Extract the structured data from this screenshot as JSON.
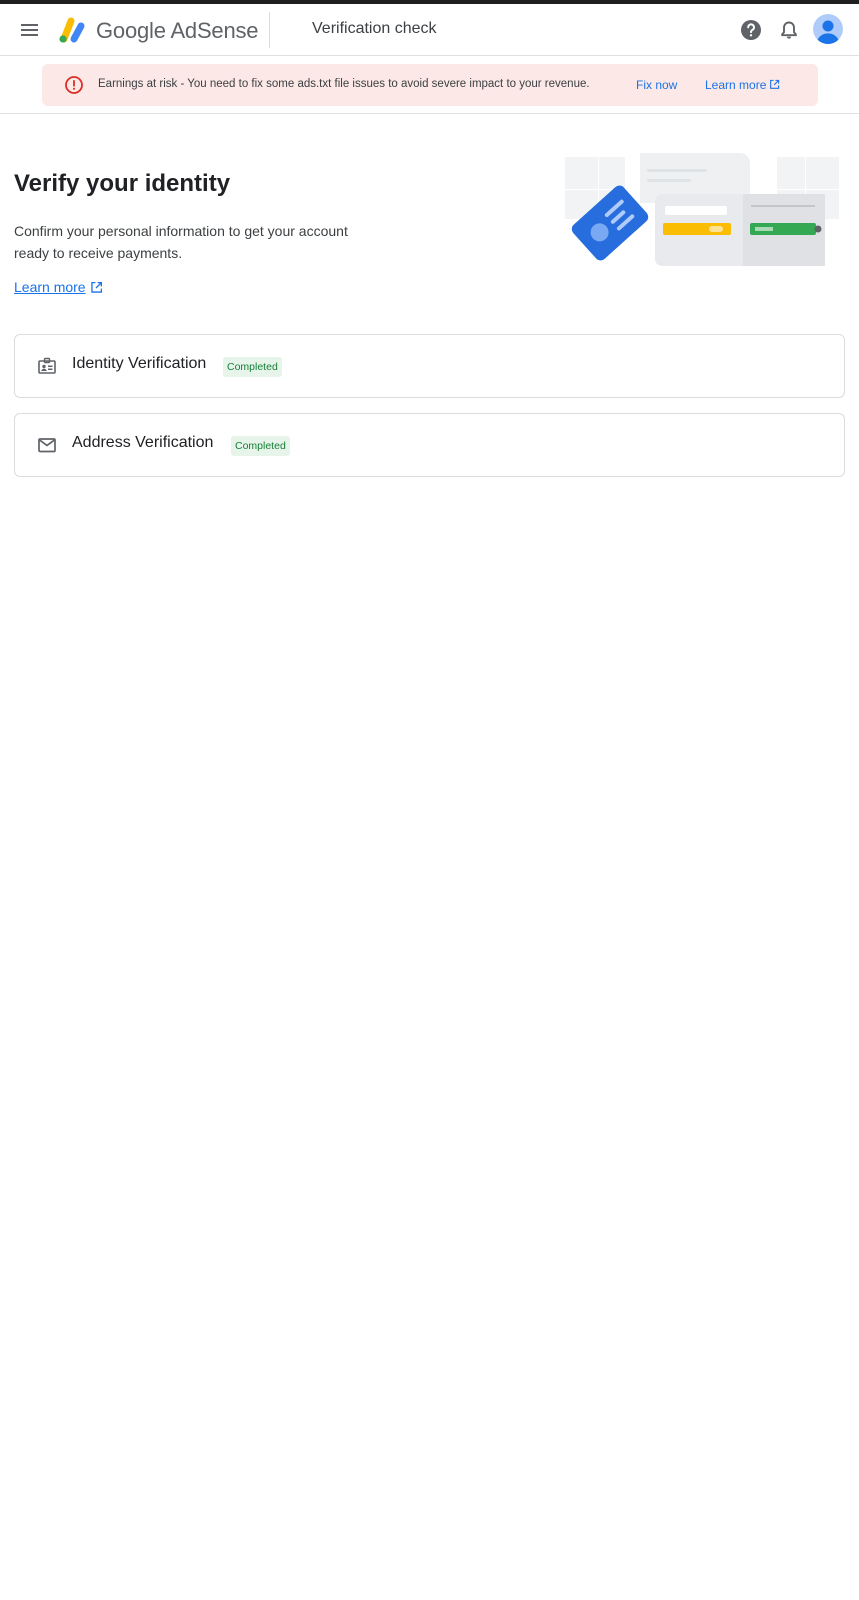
{
  "app": {
    "brand": "Google AdSense",
    "page_title": "Verification check"
  },
  "alert": {
    "message": "Earnings at risk - You need to fix some ads.txt file issues to avoid severe impact to your revenue.",
    "fix_label": "Fix now",
    "learn_label": "Learn more"
  },
  "main": {
    "heading": "Verify your identity",
    "description": "Confirm your personal information to get your account ready to receive payments.",
    "learn_more": "Learn more"
  },
  "cards": [
    {
      "title": "Identity Verification",
      "status": "Completed",
      "icon": "id-badge-icon"
    },
    {
      "title": "Address Verification",
      "status": "Completed",
      "icon": "mail-icon"
    }
  ],
  "icons": {
    "menu": "menu-icon",
    "help": "help-icon",
    "notifications": "bell-icon",
    "avatar": "avatar"
  },
  "colors": {
    "accent": "#1a73e8",
    "alert_bg": "#fce8e6",
    "alert_icon": "#d93025",
    "success_text": "#188038",
    "success_bg": "#e6f4ea",
    "logo_yellow": "#fbbc04",
    "logo_blue": "#4285f4",
    "logo_green": "#34a853"
  }
}
